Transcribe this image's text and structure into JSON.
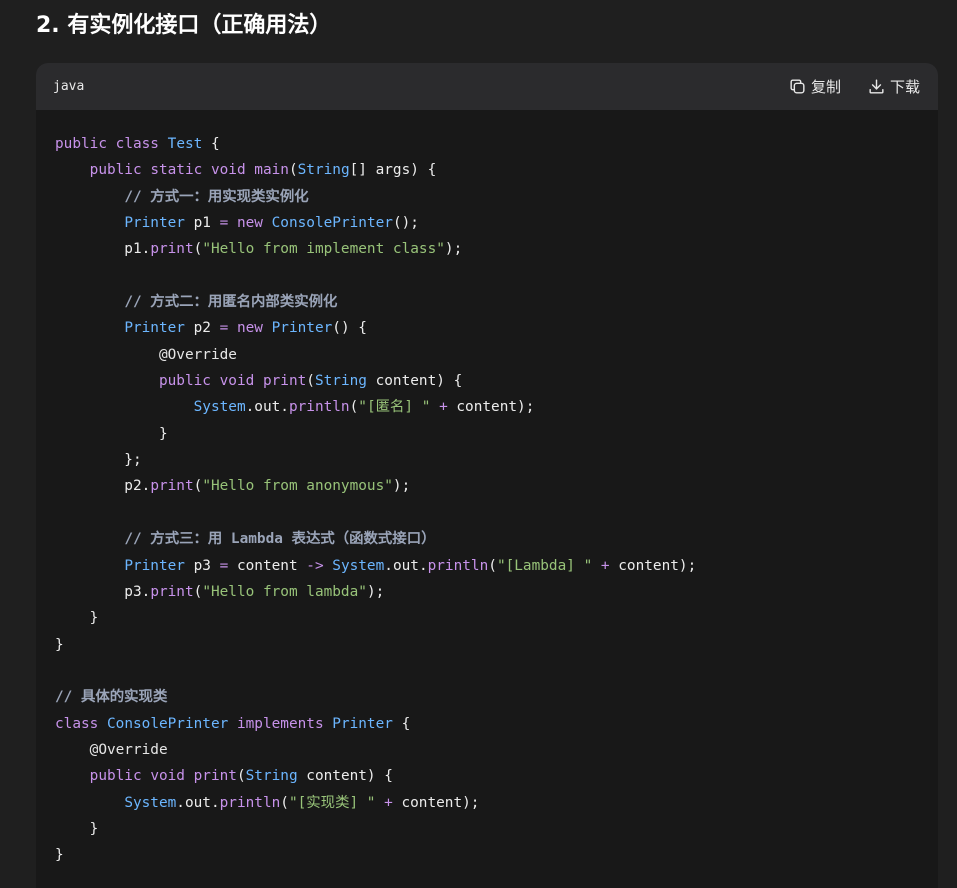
{
  "heading": "2. 有实例化接口（正确用法）",
  "code_block": {
    "language": "java",
    "copy_label": "复制",
    "download_label": "下载",
    "lines": [
      [
        [
          "kw",
          "public"
        ],
        [
          "plain",
          " "
        ],
        [
          "kw",
          "class"
        ],
        [
          "plain",
          " "
        ],
        [
          "type",
          "Test"
        ],
        [
          "plain",
          " {"
        ]
      ],
      [
        [
          "plain",
          "    "
        ],
        [
          "kw",
          "public"
        ],
        [
          "plain",
          " "
        ],
        [
          "kw",
          "static"
        ],
        [
          "plain",
          " "
        ],
        [
          "kw",
          "void"
        ],
        [
          "plain",
          " "
        ],
        [
          "fn",
          "main"
        ],
        [
          "plain",
          "("
        ],
        [
          "type",
          "String"
        ],
        [
          "plain",
          "[] args) {"
        ]
      ],
      [
        [
          "plain",
          "        "
        ],
        [
          "cmt",
          "// 方式一：用实现类实例化"
        ]
      ],
      [
        [
          "plain",
          "        "
        ],
        [
          "type",
          "Printer"
        ],
        [
          "plain",
          " p1 "
        ],
        [
          "op",
          "="
        ],
        [
          "plain",
          " "
        ],
        [
          "kw",
          "new"
        ],
        [
          "plain",
          " "
        ],
        [
          "type",
          "ConsolePrinter"
        ],
        [
          "plain",
          "();"
        ]
      ],
      [
        [
          "plain",
          "        p1."
        ],
        [
          "fn",
          "print"
        ],
        [
          "plain",
          "("
        ],
        [
          "str",
          "\"Hello from implement class\""
        ],
        [
          "plain",
          ");"
        ]
      ],
      [
        [
          "plain",
          ""
        ]
      ],
      [
        [
          "plain",
          "        "
        ],
        [
          "cmt",
          "// 方式二：用匿名内部类实例化"
        ]
      ],
      [
        [
          "plain",
          "        "
        ],
        [
          "type",
          "Printer"
        ],
        [
          "plain",
          " p2 "
        ],
        [
          "op",
          "="
        ],
        [
          "plain",
          " "
        ],
        [
          "kw",
          "new"
        ],
        [
          "plain",
          " "
        ],
        [
          "type",
          "Printer"
        ],
        [
          "plain",
          "() {"
        ]
      ],
      [
        [
          "plain",
          "            "
        ],
        [
          "ann",
          "@Override"
        ]
      ],
      [
        [
          "plain",
          "            "
        ],
        [
          "kw",
          "public"
        ],
        [
          "plain",
          " "
        ],
        [
          "kw",
          "void"
        ],
        [
          "plain",
          " "
        ],
        [
          "fn",
          "print"
        ],
        [
          "plain",
          "("
        ],
        [
          "type",
          "String"
        ],
        [
          "plain",
          " content) {"
        ]
      ],
      [
        [
          "plain",
          "                "
        ],
        [
          "type",
          "System"
        ],
        [
          "plain",
          "."
        ],
        [
          "plain",
          "out"
        ],
        [
          "plain",
          "."
        ],
        [
          "fn",
          "println"
        ],
        [
          "plain",
          "("
        ],
        [
          "str",
          "\"[匿名] \""
        ],
        [
          "plain",
          " "
        ],
        [
          "op",
          "+"
        ],
        [
          "plain",
          " content);"
        ]
      ],
      [
        [
          "plain",
          "            }"
        ]
      ],
      [
        [
          "plain",
          "        };"
        ]
      ],
      [
        [
          "plain",
          "        p2."
        ],
        [
          "fn",
          "print"
        ],
        [
          "plain",
          "("
        ],
        [
          "str",
          "\"Hello from anonymous\""
        ],
        [
          "plain",
          ");"
        ]
      ],
      [
        [
          "plain",
          ""
        ]
      ],
      [
        [
          "plain",
          "        "
        ],
        [
          "cmt",
          "// 方式三：用 Lambda 表达式（函数式接口）"
        ]
      ],
      [
        [
          "plain",
          "        "
        ],
        [
          "type",
          "Printer"
        ],
        [
          "plain",
          " p3 "
        ],
        [
          "op",
          "="
        ],
        [
          "plain",
          " content "
        ],
        [
          "op",
          "->"
        ],
        [
          "plain",
          " "
        ],
        [
          "type",
          "System"
        ],
        [
          "plain",
          "."
        ],
        [
          "plain",
          "out"
        ],
        [
          "plain",
          "."
        ],
        [
          "fn",
          "println"
        ],
        [
          "plain",
          "("
        ],
        [
          "str",
          "\"[Lambda] \""
        ],
        [
          "plain",
          " "
        ],
        [
          "op",
          "+"
        ],
        [
          "plain",
          " content);"
        ]
      ],
      [
        [
          "plain",
          "        p3."
        ],
        [
          "fn",
          "print"
        ],
        [
          "plain",
          "("
        ],
        [
          "str",
          "\"Hello from lambda\""
        ],
        [
          "plain",
          ");"
        ]
      ],
      [
        [
          "plain",
          "    }"
        ]
      ],
      [
        [
          "plain",
          "}"
        ]
      ],
      [
        [
          "plain",
          ""
        ]
      ],
      [
        [
          "cmt",
          "// 具体的实现类"
        ]
      ],
      [
        [
          "kw",
          "class"
        ],
        [
          "plain",
          " "
        ],
        [
          "type",
          "ConsolePrinter"
        ],
        [
          "plain",
          " "
        ],
        [
          "kw",
          "implements"
        ],
        [
          "plain",
          " "
        ],
        [
          "type",
          "Printer"
        ],
        [
          "plain",
          " {"
        ]
      ],
      [
        [
          "plain",
          "    "
        ],
        [
          "ann",
          "@Override"
        ]
      ],
      [
        [
          "plain",
          "    "
        ],
        [
          "kw",
          "public"
        ],
        [
          "plain",
          " "
        ],
        [
          "kw",
          "void"
        ],
        [
          "plain",
          " "
        ],
        [
          "fn",
          "print"
        ],
        [
          "plain",
          "("
        ],
        [
          "type",
          "String"
        ],
        [
          "plain",
          " content) {"
        ]
      ],
      [
        [
          "plain",
          "        "
        ],
        [
          "type",
          "System"
        ],
        [
          "plain",
          "."
        ],
        [
          "plain",
          "out"
        ],
        [
          "plain",
          "."
        ],
        [
          "fn",
          "println"
        ],
        [
          "plain",
          "("
        ],
        [
          "str",
          "\"[实现类] \""
        ],
        [
          "plain",
          " "
        ],
        [
          "op",
          "+"
        ],
        [
          "plain",
          " content);"
        ]
      ],
      [
        [
          "plain",
          "    }"
        ]
      ],
      [
        [
          "plain",
          "}"
        ]
      ]
    ]
  }
}
